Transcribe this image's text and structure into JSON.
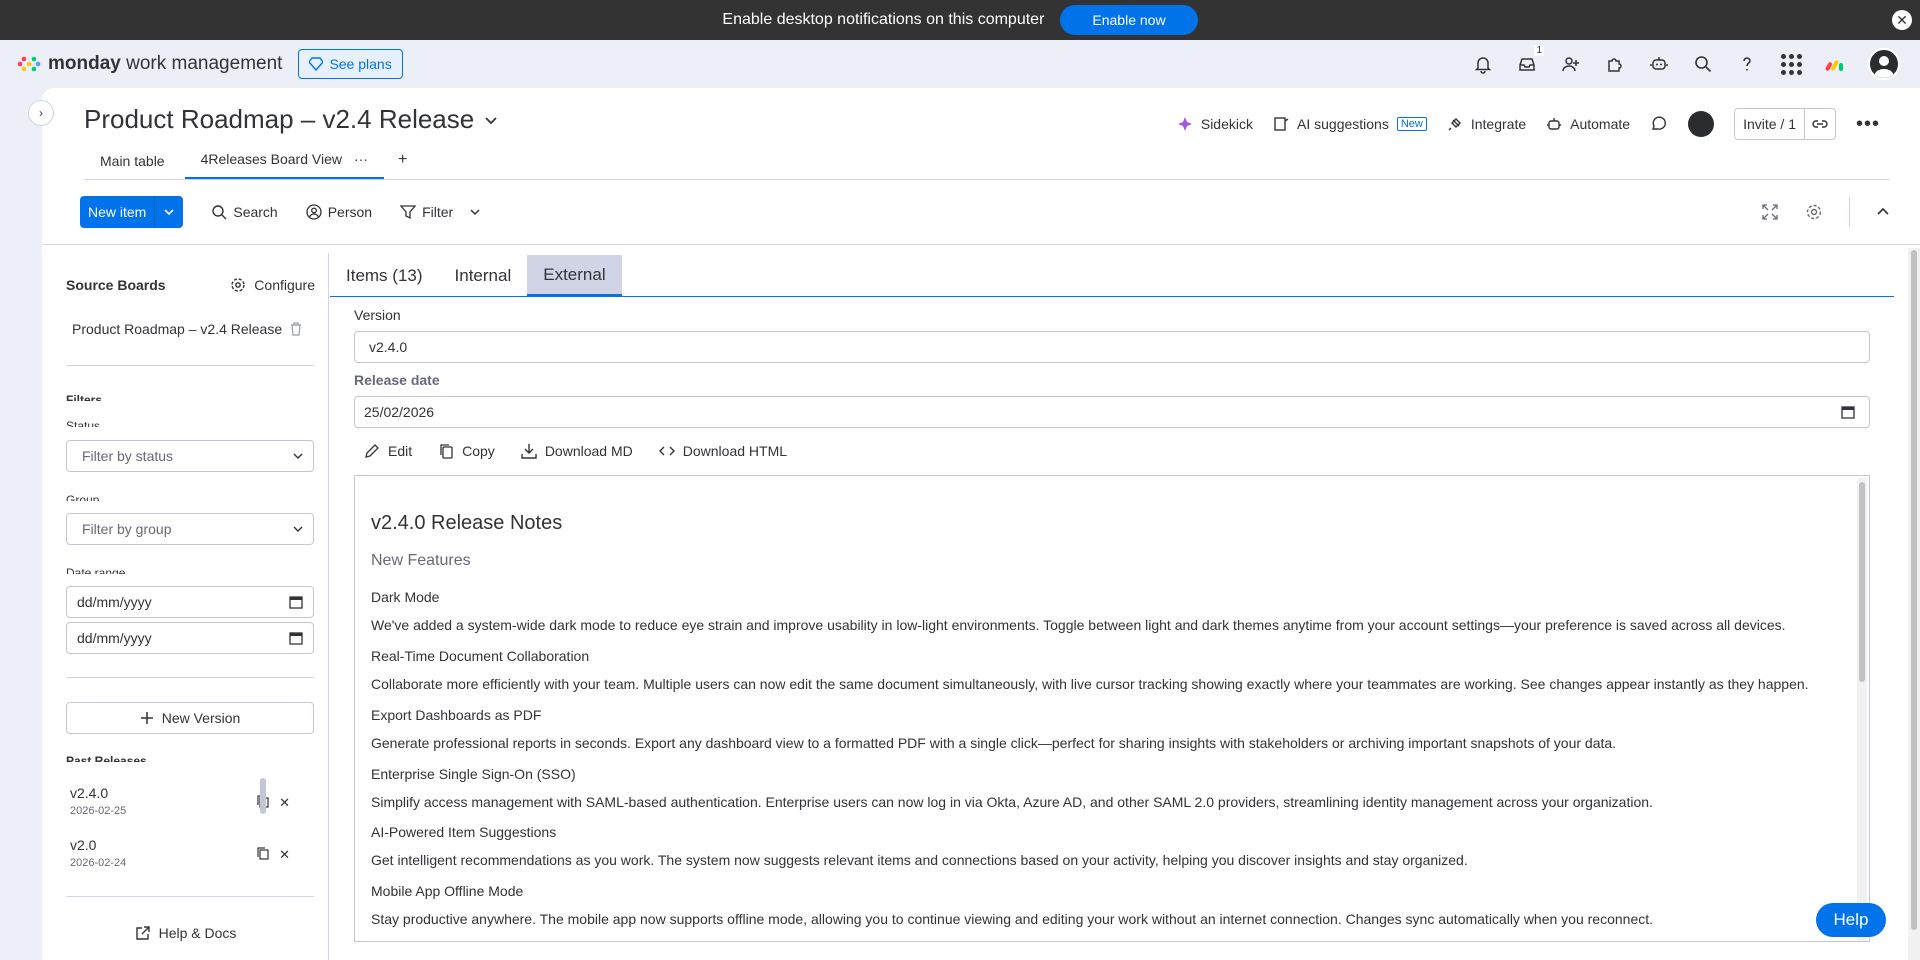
{
  "notification": {
    "message": "Enable desktop notifications on this computer",
    "button": "Enable now"
  },
  "header": {
    "brand_bold": "monday",
    "brand_rest": " work management",
    "see_plans": "See plans",
    "inbox_badge": "1"
  },
  "board": {
    "title": "Product Roadmap – v2.4 Release",
    "sidekick": "Sidekick",
    "ai_suggestions": "AI suggestions",
    "new_tag": "New",
    "integrate": "Integrate",
    "automate": "Automate",
    "invite": "Invite / 1"
  },
  "views": {
    "main_table": "Main table",
    "releases": "4Releases Board View",
    "more": "···",
    "add": "+"
  },
  "toolbar": {
    "new_item": "New item",
    "search": "Search",
    "person": "Person",
    "filter": "Filter"
  },
  "sidebar": {
    "source_boards": "Source Boards",
    "configure": "Configure",
    "board_name": "Product Roadmap – v2.4 Release",
    "filters": "Filters",
    "status_label": "Status",
    "status_placeholder": "Filter by status",
    "group_label": "Group",
    "group_placeholder": "Filter by group",
    "date_range_label": "Date range",
    "date_from": "dd/mm/yyyy",
    "date_to": "dd/mm/yyyy",
    "new_version": "New Version",
    "past_releases": "Past Releases",
    "releases": [
      {
        "version": "v2.4.0",
        "date": "2026-02-25"
      },
      {
        "version": "v2.0",
        "date": "2026-02-24"
      }
    ],
    "help_docs": "Help & Docs"
  },
  "panel": {
    "tabs": [
      "Items (13)",
      "Internal",
      "External"
    ],
    "active_tab": "External",
    "version_label": "Version",
    "version_value": "v2.4.0",
    "release_date_label": "Release date",
    "release_date_value": "25/02/2026",
    "actions": {
      "edit": "Edit",
      "copy": "Copy",
      "download_md": "Download MD",
      "download_html": "Download HTML"
    }
  },
  "notes": {
    "title": "v2.4.0 Release Notes",
    "section": "New Features",
    "features": [
      {
        "name": "Dark Mode",
        "desc": "We've added a system-wide dark mode to reduce eye strain and improve usability in low-light environments. Toggle between light and dark themes anytime from your account settings—your preference is saved across all devices."
      },
      {
        "name": "Real-Time Document Collaboration",
        "desc": "Collaborate more efficiently with your team. Multiple users can now edit the same document simultaneously, with live cursor tracking showing exactly where your teammates are working. See changes appear instantly as they happen."
      },
      {
        "name": "Export Dashboards as PDF",
        "desc": "Generate professional reports in seconds. Export any dashboard view to a formatted PDF with a single click—perfect for sharing insights with stakeholders or archiving important snapshots of your data."
      },
      {
        "name": "Enterprise Single Sign-On (SSO)",
        "desc": "Simplify access management with SAML-based authentication. Enterprise users can now log in via Okta, Azure AD, and other SAML 2.0 providers, streamlining identity management across your organization."
      },
      {
        "name": "AI-Powered Item Suggestions",
        "desc": "Get intelligent recommendations as you work. The system now suggests relevant items and connections based on your activity, helping you discover insights and stay organized."
      },
      {
        "name": "Mobile App Offline Mode",
        "desc": "Stay productive anywhere. The mobile app now supports offline mode, allowing you to continue viewing and editing your work without an internet connection. Changes sync automatically when you reconnect."
      }
    ]
  },
  "help_button": "Help",
  "colors": {
    "primary": "#0073ea",
    "topbar": "#333333",
    "canvas": "#eceff8"
  }
}
